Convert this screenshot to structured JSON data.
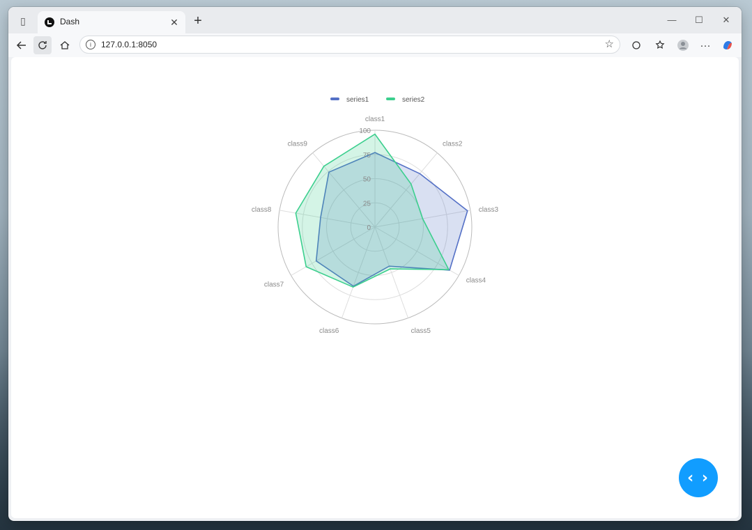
{
  "browser": {
    "tab_title": "Dash",
    "url": "127.0.0.1:8050",
    "new_tab_label": "+",
    "tab_close_label": "✕",
    "minimize_label": "—",
    "maximize_label": "☐",
    "close_label": "✕"
  },
  "toolbar": {
    "back_icon": "arrow-left-icon",
    "refresh_icon": "refresh-icon",
    "home_icon": "home-icon",
    "more_label": "···"
  },
  "fab": {
    "label": "‹ ›",
    "icon": "code-toggle-icon",
    "color": "#119dff"
  },
  "chart_data": {
    "type": "radar",
    "title": "",
    "indicators": [
      "class1",
      "class2",
      "class3",
      "class4",
      "class5",
      "class6",
      "class7",
      "class8",
      "class9"
    ],
    "max": 100,
    "ticks": [
      "0",
      "25",
      "50",
      "75",
      "100"
    ],
    "legend_position": "top-center",
    "series": [
      {
        "name": "series1",
        "color": "#5470c6",
        "values": [
          77,
          72,
          97,
          89,
          43,
          65,
          70,
          57,
          74
        ]
      },
      {
        "name": "series2",
        "color": "#3ccf8e",
        "values": [
          96,
          58,
          50,
          88,
          46,
          66,
          82,
          83,
          82
        ]
      }
    ]
  }
}
